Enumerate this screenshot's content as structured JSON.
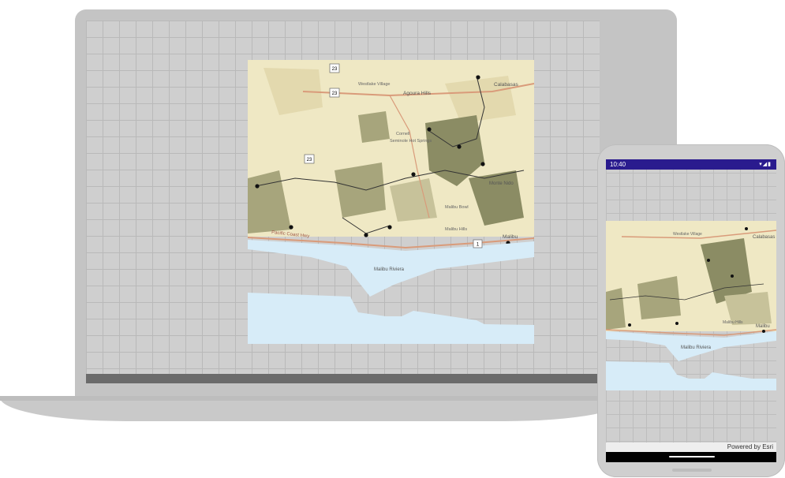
{
  "map": {
    "place_labels": [
      "Westlake Village",
      "Agoura Hills",
      "Calabasas",
      "Cornell",
      "Seminole Hot Springs",
      "Monte Nido",
      "Malibu Bowl",
      "Malibu Hills",
      "Malibu",
      "Pacific Coast Hwy",
      "Malibu Riviera"
    ],
    "road_shields": [
      "23",
      "23",
      "23",
      "1"
    ],
    "colors": {
      "land": "#efe8c4",
      "park": "#8b8c64",
      "water": "#d7ecf8",
      "road": "#d99b7a"
    }
  },
  "phone": {
    "status_time": "10:40",
    "attribution": "Powered by Esri",
    "status_color": "#2a1b8e"
  }
}
